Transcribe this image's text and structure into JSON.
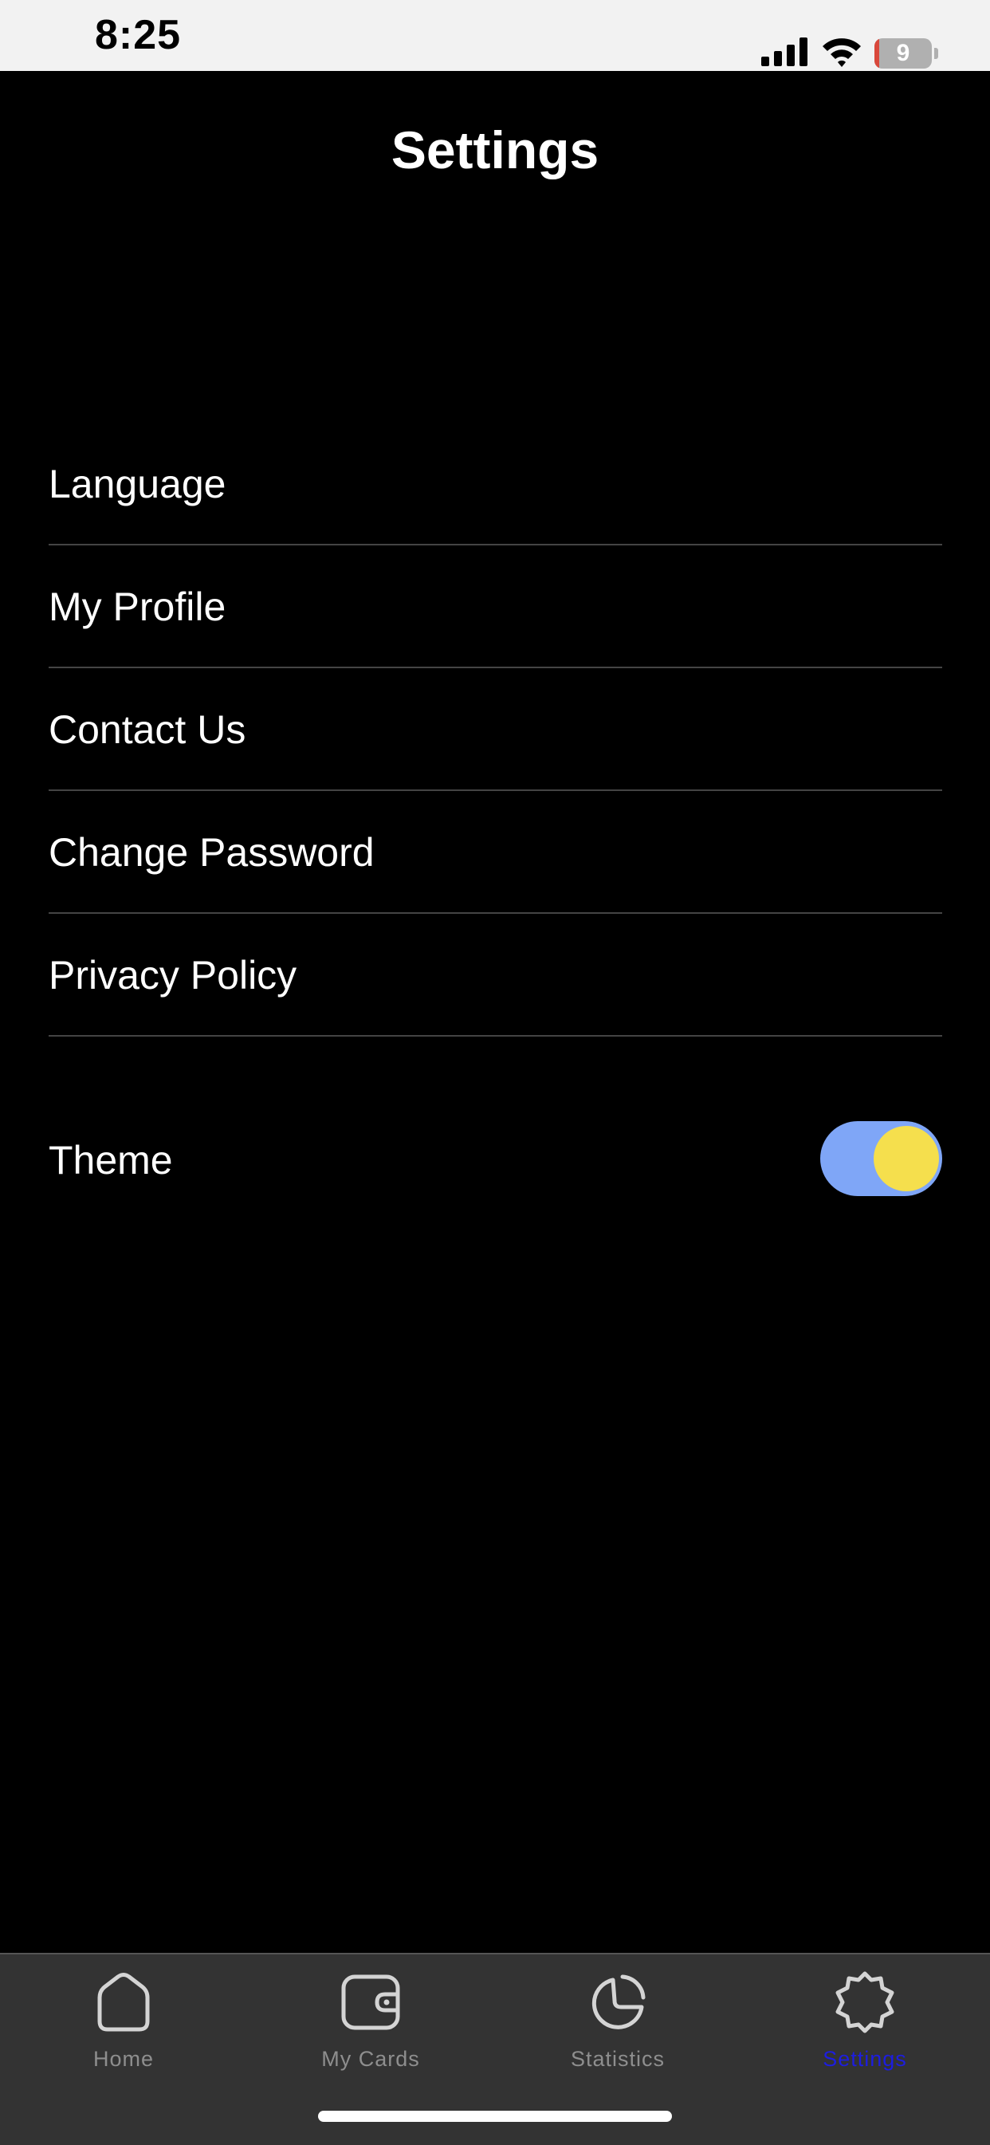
{
  "status_bar": {
    "time": "8:25",
    "battery_level": "9",
    "icons": [
      "signal-icon",
      "wifi-icon",
      "battery-icon"
    ]
  },
  "header": {
    "title": "Settings"
  },
  "menu": {
    "items": [
      {
        "label": "Language"
      },
      {
        "label": "My Profile"
      },
      {
        "label": "Contact Us"
      },
      {
        "label": "Change Password"
      },
      {
        "label": "Privacy Policy"
      }
    ]
  },
  "theme": {
    "label": "Theme",
    "enabled": true
  },
  "tab_bar": {
    "tabs": [
      {
        "label": "Home",
        "icon": "home-icon",
        "active": false
      },
      {
        "label": "My Cards",
        "icon": "wallet-icon",
        "active": false
      },
      {
        "label": "Statistics",
        "icon": "pie-chart-icon",
        "active": false
      },
      {
        "label": "Settings",
        "icon": "gear-icon",
        "active": true
      }
    ]
  },
  "colors": {
    "background": "#000000",
    "text": "#ffffff",
    "divider": "#444444",
    "toggle_track": "#7fa6f7",
    "toggle_knob": "#f5df4d",
    "tab_bar": "#333333",
    "tab_inactive": "#8e8e8e",
    "tab_active": "#1d1de0"
  }
}
